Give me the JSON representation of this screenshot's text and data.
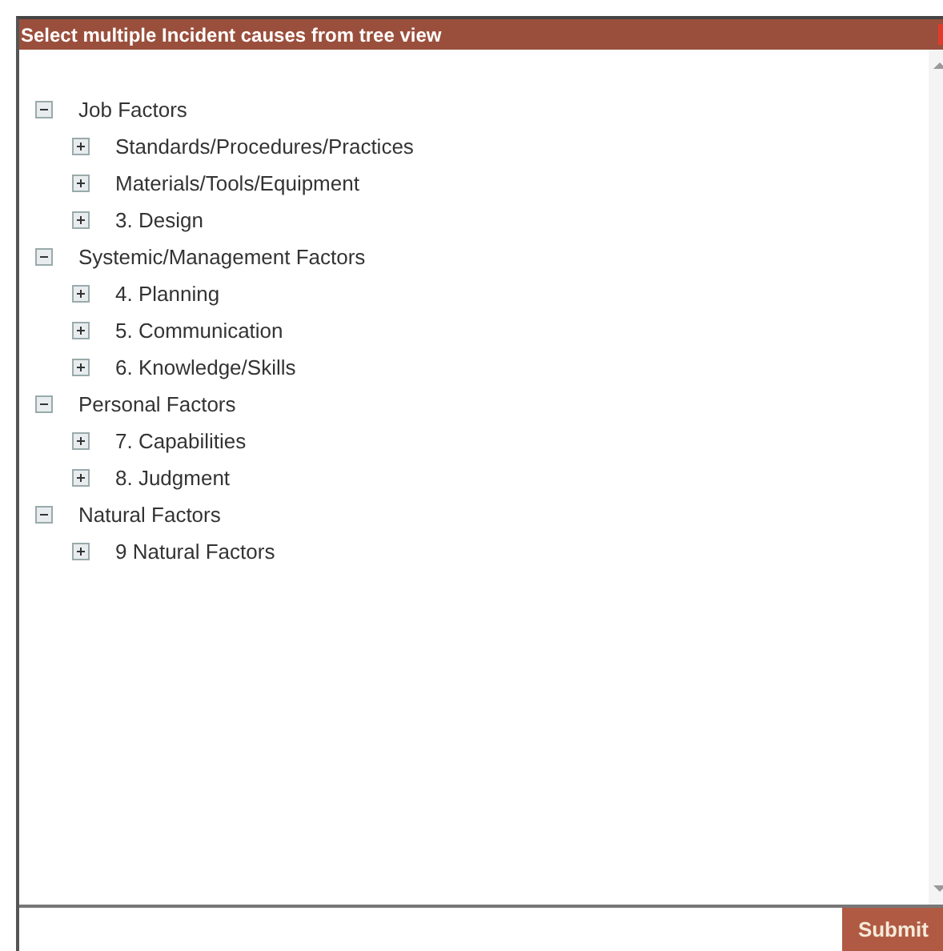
{
  "dialog": {
    "title": "Select multiple Incident causes from tree view"
  },
  "tree": [
    {
      "label": "Job Factors",
      "expanded": true,
      "children": [
        {
          "label": "Standards/Procedures/Practices",
          "expanded": false
        },
        {
          "label": "Materials/Tools/Equipment",
          "expanded": false
        },
        {
          "label": "3. Design",
          "expanded": false
        }
      ]
    },
    {
      "label": "Systemic/Management Factors",
      "expanded": true,
      "children": [
        {
          "label": "4. Planning",
          "expanded": false
        },
        {
          "label": "5. Communication",
          "expanded": false
        },
        {
          "label": "6. Knowledge/Skills",
          "expanded": false
        }
      ]
    },
    {
      "label": "Personal Factors",
      "expanded": true,
      "children": [
        {
          "label": "7. Capabilities",
          "expanded": false
        },
        {
          "label": "8. Judgment",
          "expanded": false
        }
      ]
    },
    {
      "label": "Natural Factors",
      "expanded": true,
      "children": [
        {
          "label": "9 Natural Factors",
          "expanded": false
        }
      ]
    }
  ],
  "buttons": [
    "Submit"
  ]
}
